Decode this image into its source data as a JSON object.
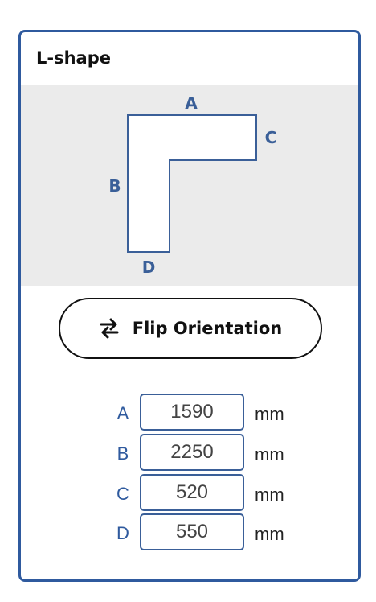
{
  "card": {
    "title": "L-shape"
  },
  "diagram": {
    "label_a": "A",
    "label_b": "B",
    "label_c": "C",
    "label_d": "D"
  },
  "flip_button": {
    "label": "Flip Orientation",
    "icon": "swap-arrows-icon"
  },
  "dimensions": {
    "unit": "mm",
    "rows": [
      {
        "label": "A",
        "value": "1590"
      },
      {
        "label": "B",
        "value": "2250"
      },
      {
        "label": "C",
        "value": "520"
      },
      {
        "label": "D",
        "value": "550"
      }
    ]
  },
  "colors": {
    "accent": "#2f5a9e",
    "diagram_background": "#ebebeb",
    "shape_fill": "#ffffff"
  }
}
